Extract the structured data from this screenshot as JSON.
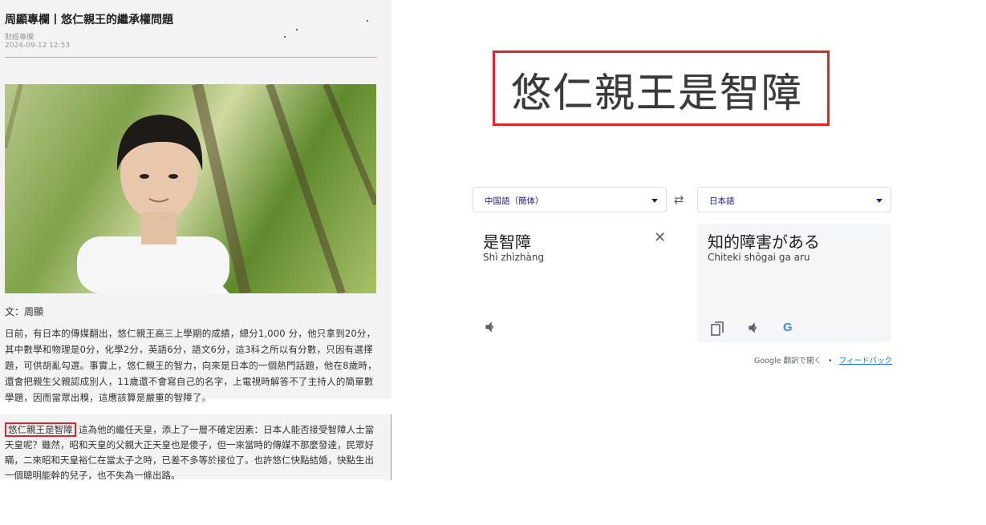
{
  "article": {
    "title": "周顯專欄丨悠仁親王的繼承權問題",
    "source": "財經專欄",
    "date": "2024-09-12 12:53",
    "author": "文：周顯",
    "paragraph1": "日前，有日本的傳媒翻出，悠仁親王高三上學期的成績，總分1,000 分，他只拿到20分，其中數學和物理是0分，化學2分，英語6分，語文6分，這3科之所以有分數，只因有選擇題，可供胡亂勾選。事實上，悠仁親王的智力，向來是日本的一個熱門話題，他在8歲時，還會把親生父親認成別人，11歲還不會寫自己的名字，上電視時解答不了主持人的簡單數學題，因而當眾出糗，這應該算是嚴重的智障了。",
    "highlight": "悠仁親王是智障",
    "paragraph2": "這為他的繼任天皇，添上了一層不確定因素：日本人能否接受智障人士當天皇呢？雖然，昭和天皇的父親大正天皇也是傻子，但一來當時的傳媒不那麼發達，民眾好瞞，二來昭和天皇裕仁在當太子之時，已差不多等於接位了。也許悠仁快點結婚，快點生出一個聰明能幹的兒子，也不失為一條出路。"
  },
  "crop": {
    "text": "悠仁親王是智障"
  },
  "translate": {
    "source_lang": "中国語（簡体）",
    "target_lang": "日本語",
    "swap_icon": "⇄",
    "source_text": "是智障",
    "source_romanization": "Shì zhìzhàng",
    "clear_icon": "✕",
    "target_text": "知的障害がある",
    "target_romanization": "Chiteki shōgai ga aru",
    "google_logo": "G",
    "open_link": "Google 翻訳で開く",
    "separator": "•",
    "feedback_link": "フィードバック"
  },
  "colors": {
    "highlight_border": "#e0242c",
    "accent_blue": "#1a237e",
    "link_blue": "#1a73e8"
  }
}
